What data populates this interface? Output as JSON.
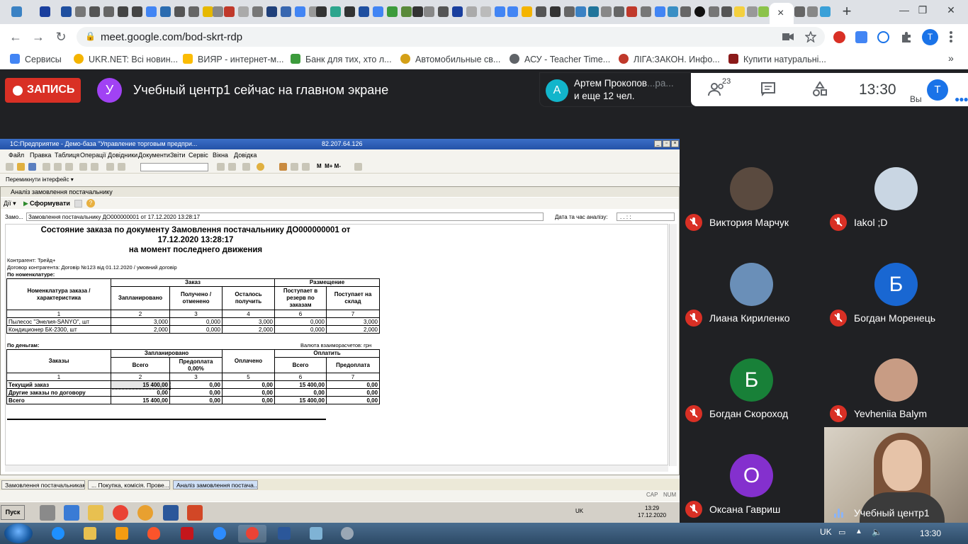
{
  "browser": {
    "url": "meet.google.com/bod-skrt-rdp",
    "active_tab_close": "×",
    "new_tab": "+",
    "profile_initial": "T",
    "window_controls": {
      "minimize": "—",
      "restore": "❐",
      "close": "✕"
    },
    "nav": {
      "back": "←",
      "forward": "→",
      "reload": "↻"
    },
    "bookmarks": [
      {
        "label": "Сервисы",
        "color": "#4285f4"
      },
      {
        "label": "UKR.NET: Всі новин...",
        "color": "#f4b400"
      },
      {
        "label": "ВИЯР - интернет-м...",
        "color": "#fbbc04"
      },
      {
        "label": "Банк для тих, хто л...",
        "color": "#3c9b3c"
      },
      {
        "label": "Автомобильные св...",
        "color": "#d4a017"
      },
      {
        "label": "АСУ - Teacher Time...",
        "color": "#5f6368"
      },
      {
        "label": "ЛІГА:ЗАКОН. Инфо...",
        "color": "#c0392b"
      },
      {
        "label": "Купити натуральні...",
        "color": "#8b1a1a"
      }
    ],
    "bookmarks_more": "»"
  },
  "meet": {
    "record_label": "ЗАПИСЬ",
    "presenter_initial": "У",
    "presenting_text": "Учебный центр1 сейчас на главном экране",
    "chat_popup": {
      "initial": "А",
      "name": "Артем Прокопов",
      "name_fade": "...ра...",
      "line2": "и еще 12 чел."
    },
    "participants_count": "23",
    "clock": "13:30",
    "you_label": "Вы",
    "you_initial": "T",
    "participants": [
      {
        "name": "Виктория Марчук",
        "initial": "",
        "color": "#5a4a3f"
      },
      {
        "name": "Iakol ;D",
        "initial": "",
        "color": "#c9d6e3"
      },
      {
        "name": "Лиана Кириленко",
        "initial": "",
        "color": "#6a8fb8"
      },
      {
        "name": "Богдан Моренець",
        "initial": "Б",
        "color": "#1967d2"
      },
      {
        "name": "Богдан Скороход",
        "initial": "Б",
        "color": "#188038"
      },
      {
        "name": "Yevheniia Balym",
        "initial": "",
        "color": "#c89c84"
      },
      {
        "name": "Оксана Гавриш",
        "initial": "О",
        "color": "#8430ce"
      }
    ],
    "self_tile_name": "Учебный центр1"
  },
  "onec": {
    "window_title": "1С:Предприятие - Демо-база \"Управление торговым предпри...",
    "remote_ip": "82.207.64.126",
    "menu": [
      "Файл",
      "Правка",
      "Таблиця",
      "Операції",
      "Довідники",
      "Документи",
      "Звіти",
      "Сервіс",
      "Вікна",
      "Довідка"
    ],
    "interface_switch": "Перемикнути інтерфейс ▾",
    "report_window_title": "Аналіз замовлення постачальнику",
    "actions_label": "Дії ▾",
    "generate_label": "Сформувати",
    "order_label": "Замо...",
    "order_value": "Замовлення постачальнику ДО000000001 от 17.12.2020 13:28:17",
    "date_label": "Дата та час аналізу:",
    "date_value": ". .   :  :",
    "report": {
      "title1": "Состояние заказа по документу Замовлення постачальнику ДО000000001 от",
      "title2": "17.12.2020 13:28:17",
      "title3": "на момент последнего движения",
      "contractor": "Контрагент: Трейд+",
      "contract": "Договор контрагента: Договір №123 від 01.12.2020 / умовний договір",
      "by_nomenclature": "По номенклатуре:",
      "t1_headers": {
        "nomenclature": "Номенклатура заказа / характеристика",
        "order_group": "Заказ",
        "placement_group": "Размещение",
        "planned": "Запланировано",
        "received": "Получено / отменено",
        "remaining": "Осталось получить",
        "reserve": "Поступает в резерв по заказам",
        "warehouse": "Поступает на склад"
      },
      "t1_numbers": [
        "1",
        "2",
        "3",
        "4",
        "6",
        "7"
      ],
      "t1_rows": [
        [
          "Пылесос \"Энелия-SANYO\", шт",
          "3,000",
          "0,000",
          "3,000",
          "0,000",
          "3,000"
        ],
        [
          "Кондиционер БК-2300, шт",
          "2,000",
          "0,000",
          "2,000",
          "0,000",
          "2,000"
        ]
      ],
      "by_money": "По деньгам:",
      "currency": "Валюта взаиморасчетов: грн",
      "t2_headers": {
        "orders": "Заказы",
        "planned_group": "Запланировано",
        "paid": "Оплачено",
        "to_pay_group": "Оплатить",
        "total": "Всего",
        "prepay": "Предоплата",
        "prepay_pct": "0,00%",
        "total2": "Всего",
        "prepay2": "Предоплата"
      },
      "t2_numbers": [
        "1",
        "2",
        "3",
        "5",
        "6",
        "7"
      ],
      "t2_rows": [
        [
          "Текущий заказ",
          "15 400,00",
          "0,00",
          "0,00",
          "15 400,00",
          "0,00"
        ],
        [
          "Другие заказы по договору",
          "0,00",
          "0,00",
          "0,00",
          "0,00",
          "0,00"
        ],
        [
          "Всего",
          "15 400,00",
          "0,00",
          "0,00",
          "15 400,00",
          "0,00"
        ]
      ]
    },
    "window_tabs": [
      "Замовлення постачальникам",
      "... Покупка, комісія. Прове...",
      "Аналіз замовлення постача..."
    ],
    "status": {
      "cap": "CAP",
      "num": "NUM"
    },
    "xp_start": "Пуск",
    "xp_tray": {
      "lang": "UK",
      "time": "13:29",
      "date": "17.12.2020"
    }
  },
  "win7": {
    "lang": "UK",
    "time": "13:30"
  }
}
